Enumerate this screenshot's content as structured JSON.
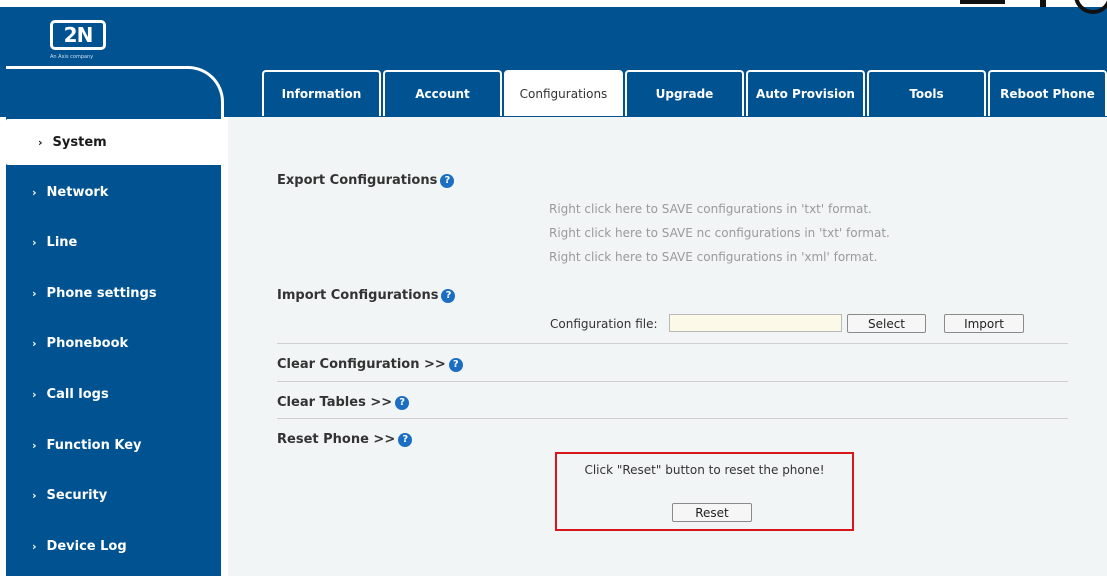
{
  "brand": {
    "logo_text": "2N",
    "tagline": "An Axis company"
  },
  "tabs": [
    {
      "label": "Information"
    },
    {
      "label": "Account"
    },
    {
      "label": "Configurations"
    },
    {
      "label": "Upgrade"
    },
    {
      "label": "Auto Provision"
    },
    {
      "label": "Tools"
    },
    {
      "label": "Reboot Phone"
    }
  ],
  "active_tab": "Configurations",
  "sidebar": {
    "items": [
      {
        "label": "System"
      },
      {
        "label": "Network"
      },
      {
        "label": "Line"
      },
      {
        "label": "Phone settings"
      },
      {
        "label": "Phonebook"
      },
      {
        "label": "Call logs"
      },
      {
        "label": "Function Key"
      },
      {
        "label": "Security"
      },
      {
        "label": "Device Log"
      }
    ],
    "active": "System",
    "chevron": "›"
  },
  "sections": {
    "export": {
      "title": "Export Configurations",
      "links": [
        "Right click here to SAVE configurations in 'txt' format.",
        "Right click here to SAVE nc configurations in 'txt' format.",
        "Right click here to SAVE configurations in 'xml' format."
      ]
    },
    "import": {
      "title": "Import Configurations",
      "file_label": "Configuration file:",
      "file_value": "",
      "select_label": "Select",
      "import_label": "Import"
    },
    "clear_config": {
      "title": "Clear Configuration >>"
    },
    "clear_tables": {
      "title": "Clear Tables >>"
    },
    "reset": {
      "title": "Reset Phone >>",
      "message": "Click \"Reset\" button to reset the phone!",
      "button_label": "Reset"
    }
  },
  "help_icon": "?",
  "colors": {
    "brand_blue": "#015291",
    "highlight_red": "#d9161c",
    "help_blue": "#1b6ec2"
  }
}
